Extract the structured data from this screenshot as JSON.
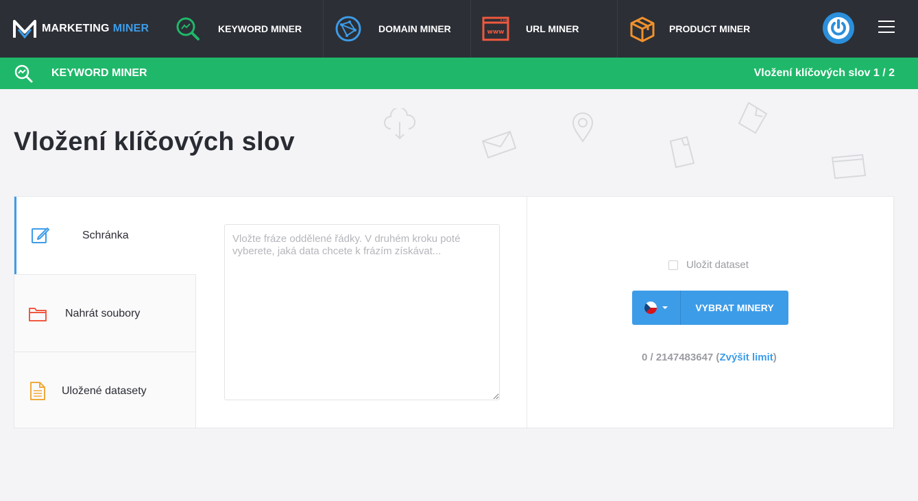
{
  "app": {
    "logo_main": "MARKETING",
    "logo_accent": "MINER"
  },
  "nav": {
    "items": [
      {
        "label": "KEYWORD MINER",
        "icon": "keyword-magnifier-icon"
      },
      {
        "label": "DOMAIN MINER",
        "icon": "globe-network-icon"
      },
      {
        "label": "URL MINER",
        "icon": "browser-www-icon"
      },
      {
        "label": "PRODUCT MINER",
        "icon": "box-icon"
      }
    ]
  },
  "subheader": {
    "title": "KEYWORD MINER",
    "step": "Vložení klíčových slov 1 / 2"
  },
  "page": {
    "title": "Vložení klíčových slov"
  },
  "tabs": [
    {
      "label": "Schránka",
      "icon": "pencil-edit-icon",
      "active": true
    },
    {
      "label": "Nahrát soubory",
      "icon": "folder-icon",
      "active": false
    },
    {
      "label": "Uložené datasety",
      "icon": "document-icon",
      "active": false
    }
  ],
  "input": {
    "value": "",
    "placeholder": "Vložte fráze oddělené řádky. V druhém kroku poté vyberete, jaká data chcete k frázím získávat..."
  },
  "actions": {
    "save_dataset_label": "Uložit dataset",
    "save_dataset_checked": false,
    "country_flag": "czech-flag-icon",
    "select_miners_label": "VYBRAT MINERY",
    "limit_text": "0 / 2147483647 (",
    "limit_link": "Zvýšit limit",
    "limit_close": ")"
  },
  "colors": {
    "topbar": "#2c2f36",
    "green": "#1fb86a",
    "blue": "#3d9ce8"
  }
}
